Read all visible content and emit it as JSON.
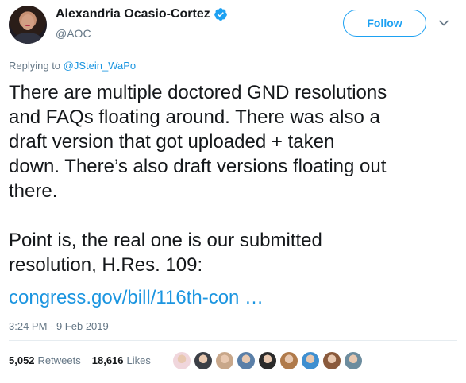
{
  "author": {
    "display_name": "Alexandria Ocasio-Cortez",
    "handle": "@AOC",
    "verified_icon": "verified-badge-icon",
    "avatar_icon": "profile-photo"
  },
  "follow_button": {
    "label": "Follow"
  },
  "menu": {
    "icon": "chevron-down-icon"
  },
  "reply": {
    "prefix": "Replying to ",
    "mention": "@JStein_WaPo"
  },
  "tweet": {
    "text": "There are multiple doctored GND resolutions\nand FAQs floating around. There was also a\ndraft version that got uploaded + taken\ndown. There’s also draft versions floating out\nthere.\n\nPoint is, the real one is our submitted\nresolution, H.Res. 109:",
    "link": "congress.gov/bill/116th-con …"
  },
  "timestamp": "3:24 PM - 9 Feb 2019",
  "stats": {
    "retweets_count": "5,052",
    "retweets_label": "Retweets",
    "likes_count": "18,616",
    "likes_label": "Likes"
  },
  "colors": {
    "link": "#1b95e0",
    "accent": "#1da1f2",
    "text": "#14171a",
    "muted": "#657786",
    "divider": "#e6ecf0"
  },
  "likers": [
    {
      "name": "liker-avatar-1",
      "color": "#f0d6dc"
    },
    {
      "name": "liker-avatar-2",
      "color": "#3b3f46"
    },
    {
      "name": "liker-avatar-3",
      "color": "#c8a78a"
    },
    {
      "name": "liker-avatar-4",
      "color": "#5a7fa8"
    },
    {
      "name": "liker-avatar-5",
      "color": "#2b2b2b"
    },
    {
      "name": "liker-avatar-6",
      "color": "#b07a4a"
    },
    {
      "name": "liker-avatar-7",
      "color": "#3f8fd0"
    },
    {
      "name": "liker-avatar-8",
      "color": "#8a5a3c"
    },
    {
      "name": "liker-avatar-9",
      "color": "#6c8c9e"
    }
  ]
}
